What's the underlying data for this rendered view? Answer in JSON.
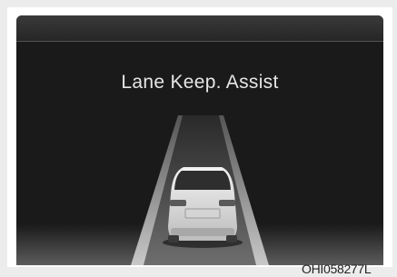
{
  "screen": {
    "title": "Lane Keep. Assist",
    "icons": {
      "road": "lane-road-icon",
      "lane_lines": "lane-lines-icon",
      "vehicle": "vehicle-rear-icon"
    },
    "colors": {
      "background": "#1a1a1a",
      "text": "#e6e6e6",
      "road": "#5a5a5a",
      "lane_lines": "#a0a0a0"
    }
  },
  "figure": {
    "code": "OHI058277L"
  }
}
